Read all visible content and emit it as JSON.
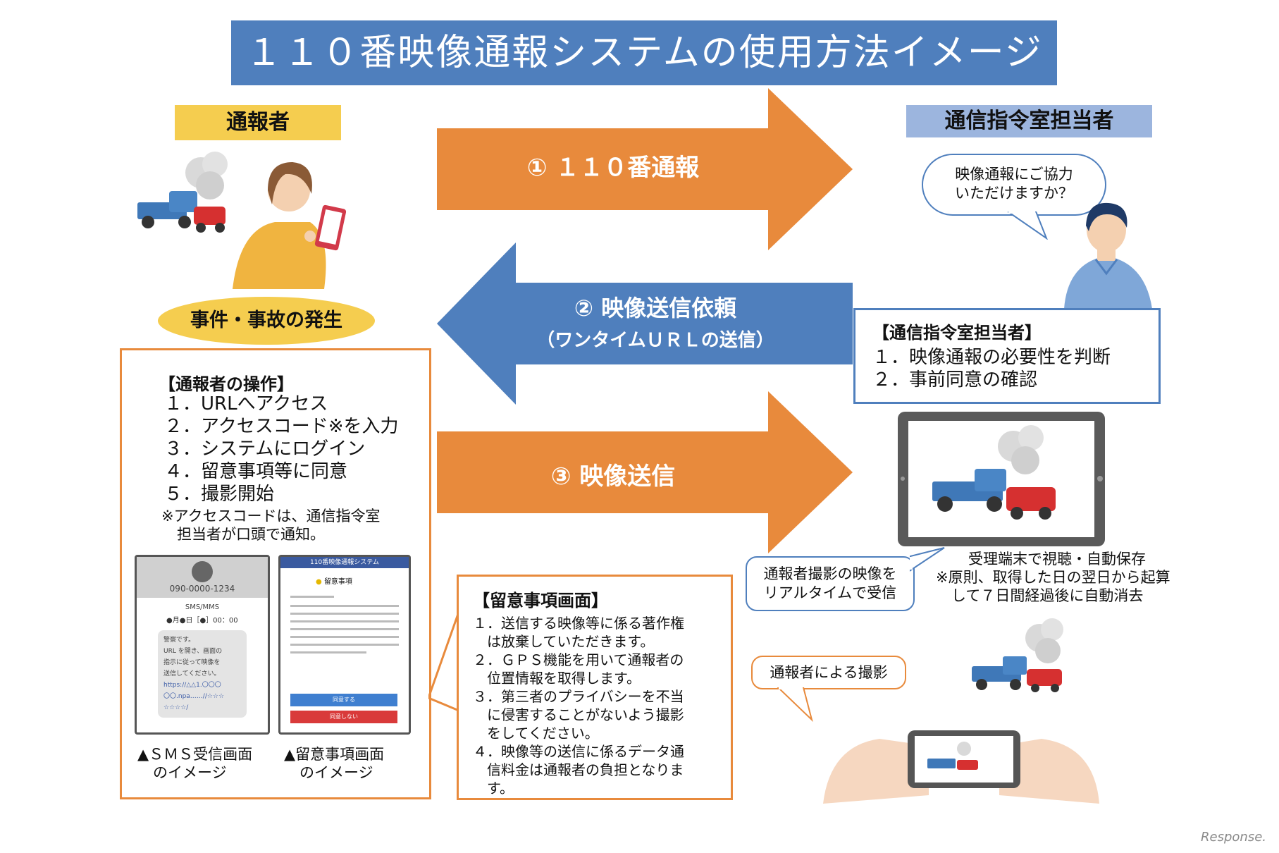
{
  "title": "１１０番映像通報システムの使用方法イメージ",
  "reporter_label": "通報者",
  "operator_label": "通信指令室担当者",
  "incident_label": "事件・事故の発生",
  "arrows": {
    "step1": "① １１０番通報",
    "step2_line1": "② 映像送信依頼",
    "step2_line2": "（ワンタイムＵＲＬの送信）",
    "step3": "③ 映像送信"
  },
  "operator_bubble": {
    "line1": "映像通報にご協力",
    "line2": "いただけますか？"
  },
  "operator_box": {
    "title": "【通信指令室担当者】",
    "items": [
      "１．映像通報の必要性を判断",
      "２．事前同意の確認"
    ]
  },
  "reporter_box": {
    "title": "【通報者の操作】",
    "items": [
      "１．URLへアクセス",
      "２．アクセスコード※を入力",
      "３．システムにログイン",
      "４．留意事項等に同意",
      "５．撮影開始"
    ],
    "note_line1": "※アクセスコードは、通信指令室",
    "note_line2": "担当者が口頭で通知。"
  },
  "sms_mock": {
    "phone_number": "090-0000-1234",
    "type": "SMS/MMS",
    "date": "●月●日［●］00：00",
    "message_lines": [
      "警察です。",
      "URL を開き、画面の",
      "指示に従って映像を",
      "送信してください。",
      "https://△△1.〇〇〇",
      "〇〇.npa……//☆☆☆",
      "☆☆☆☆/"
    ],
    "caption_line1": "▲ＳＭＳ受信画面",
    "caption_line2": "のイメージ"
  },
  "notice_mock": {
    "header": "110番映像通報システム",
    "heading": "留意事項",
    "agree": "同意する",
    "disagree": "同意しない",
    "caption_line1": "▲留意事項画面",
    "caption_line2": "のイメージ"
  },
  "notice_box": {
    "title": "【留意事項画面】",
    "items": [
      "１．送信する映像等に係る著作権",
      "　は放棄していただきます。",
      "２．ＧＰＳ機能を用いて通報者の",
      "　位置情報を取得します。",
      "３．第三者のプライバシーを不当",
      "　に侵害することがないよう撮影",
      "　をしてください。",
      "４．映像等の送信に係るデータ通",
      "　信料金は通報者の負担となりま",
      "　す。"
    ]
  },
  "receive_bubble": {
    "line1": "通報者撮影の映像を",
    "line2": "リアルタイムで受信"
  },
  "terminal_note": {
    "line1": "受理端末で視聴・自動保存",
    "line2": "※原則、取得した日の翌日から起算",
    "line3": "して７日間経過後に自動消去"
  },
  "filming_bubble": "通報者による撮影",
  "watermark": "Response.",
  "colors": {
    "title_blue": "#4f7fbd",
    "arrow_orange": "#e88a3c",
    "arrow_blue": "#4f7fbd",
    "label_yellow": "#f5cd4f",
    "label_light_blue": "#9cb5de"
  }
}
